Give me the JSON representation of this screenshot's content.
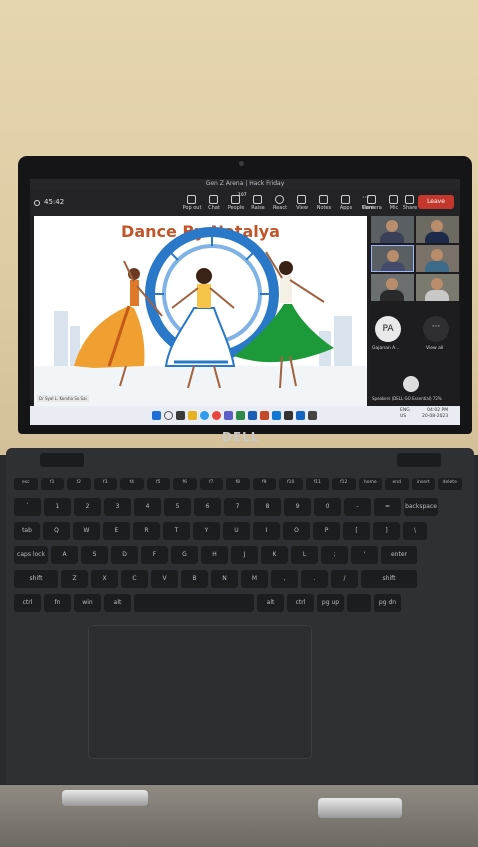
{
  "meeting": {
    "window_title": "Gen Z Arena | Hack Friday",
    "timer": "45:42",
    "toolbar": [
      {
        "label": "Pop out"
      },
      {
        "label": "Chat"
      },
      {
        "label": "People"
      },
      {
        "label": "Raise"
      },
      {
        "label": "React"
      },
      {
        "label": "View"
      },
      {
        "label": "Notes"
      },
      {
        "label": "Apps"
      },
      {
        "label": "More"
      },
      {
        "label": "Camera"
      },
      {
        "label": "Mic"
      },
      {
        "label": "Share"
      }
    ],
    "people_count": "107",
    "leave_label": "Leave",
    "slide_title": "Dance By Natalya",
    "slide_caption": "Dr Syal L. Kondia So Sai",
    "participant_initials": "PA",
    "participant_name": "Gajanan A...",
    "view_all_label": "View all",
    "speaker_label": "Speakers (DELL GO Essential) 72%"
  },
  "taskbar": {
    "lang": "ENG",
    "region": "US",
    "time": "04:02 PM",
    "date": "20-08-2023"
  },
  "laptop": {
    "brand": "DELL"
  },
  "keyboard": {
    "rows": [
      [
        "esc",
        "f1",
        "f2",
        "f3",
        "f4",
        "f5",
        "f6",
        "f7",
        "f8",
        "f9",
        "f10",
        "f11",
        "f12",
        "home",
        "end",
        "insert",
        "delete"
      ],
      [
        "`",
        "1",
        "2",
        "3",
        "4",
        "5",
        "6",
        "7",
        "8",
        "9",
        "0",
        "-",
        "=",
        "backspace"
      ],
      [
        "tab",
        "Q",
        "W",
        "E",
        "R",
        "T",
        "Y",
        "U",
        "I",
        "O",
        "P",
        "[",
        "]",
        "\\"
      ],
      [
        "caps lock",
        "A",
        "S",
        "D",
        "F",
        "G",
        "H",
        "J",
        "K",
        "L",
        ";",
        "'",
        "enter"
      ],
      [
        "shift",
        "Z",
        "X",
        "C",
        "V",
        "B",
        "N",
        "M",
        ",",
        ".",
        "/",
        "shift"
      ],
      [
        "ctrl",
        "fn",
        "win",
        "alt",
        "",
        "alt",
        "ctrl",
        "pg up",
        "",
        "pg dn"
      ]
    ]
  },
  "colors": {
    "slide_title": "#c0562a",
    "leave_button": "#c4372c",
    "chakra_blue": "#2a78c8",
    "green_dress": "#1c9a3a",
    "orange_dress": "#f0a030"
  }
}
